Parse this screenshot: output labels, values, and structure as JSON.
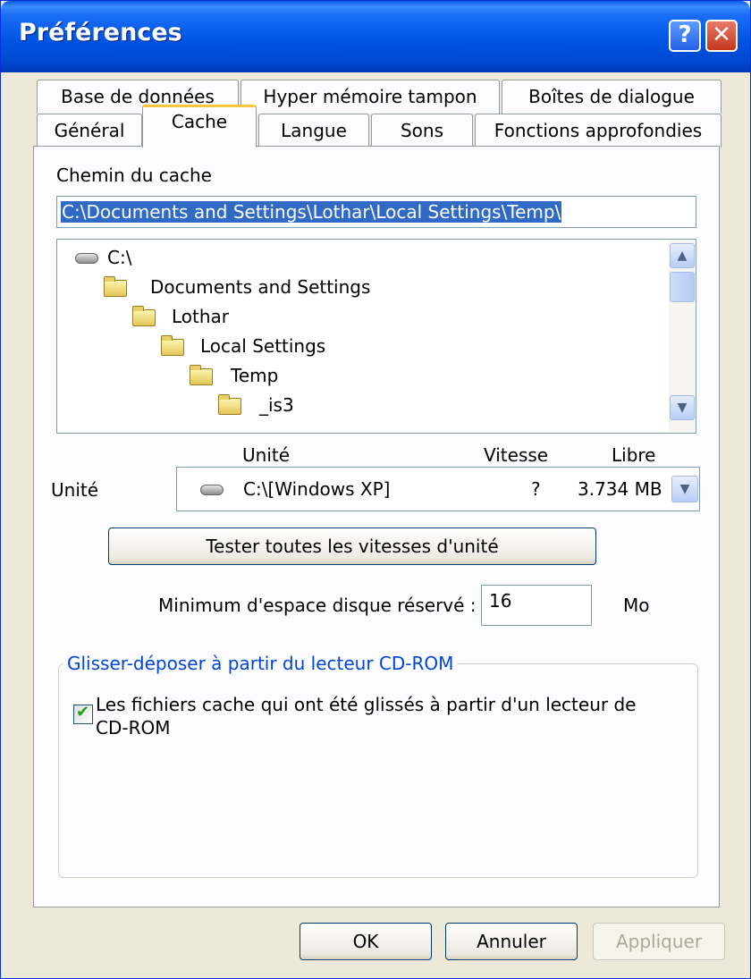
{
  "window": {
    "title": "Préférences",
    "help_label": "?",
    "close_label": "✕"
  },
  "tabs_row1": [
    "Base de données",
    "Hyper mémoire tampon",
    "Boîtes de dialogue"
  ],
  "tabs_row2": [
    "Général",
    "Cache",
    "Langue",
    "Sons",
    "Fonctions approfondies"
  ],
  "active_tab": "Cache",
  "cache_path": {
    "label": "Chemin du cache",
    "value": "C:\\Documents and Settings\\Lothar\\Local Settings\\Temp\\"
  },
  "tree": {
    "items": [
      {
        "label": "C:\\",
        "icon": "drive-icon"
      },
      {
        "label": "Documents and Settings",
        "icon": "folder-icon"
      },
      {
        "label": "Lothar",
        "icon": "folder-icon"
      },
      {
        "label": "Local Settings",
        "icon": "folder-icon"
      },
      {
        "label": "Temp",
        "icon": "folder-icon"
      },
      {
        "label": "_is3",
        "icon": "folder-icon"
      }
    ]
  },
  "drive": {
    "col_unit": "Unité",
    "col_speed": "Vitesse",
    "col_free": "Libre",
    "label": "Unité",
    "selected_name": "C:\\[Windows XP]",
    "selected_speed": "?",
    "selected_free": "3.734 MB",
    "test_button": "Tester toutes les vitesses d'unité"
  },
  "min_space": {
    "label": "Minimum d'espace disque réservé :",
    "value": "16",
    "unit": "Mo"
  },
  "cdrom": {
    "group_title": "Glisser-déposer à partir du lecteur CD-ROM",
    "checkbox_line1": "Les fichiers cache qui ont été glissés à partir d'un lecteur de",
    "checkbox_line2": "CD-ROM",
    "checked": true
  },
  "buttons": {
    "ok": "OK",
    "cancel": "Annuler",
    "apply": "Appliquer"
  },
  "colors": {
    "title_bar": "#0055e5",
    "face": "#ece9d8",
    "selection": "#316ac5",
    "group_title": "#0046d5",
    "active_tab_accent": "#ffc83c"
  }
}
